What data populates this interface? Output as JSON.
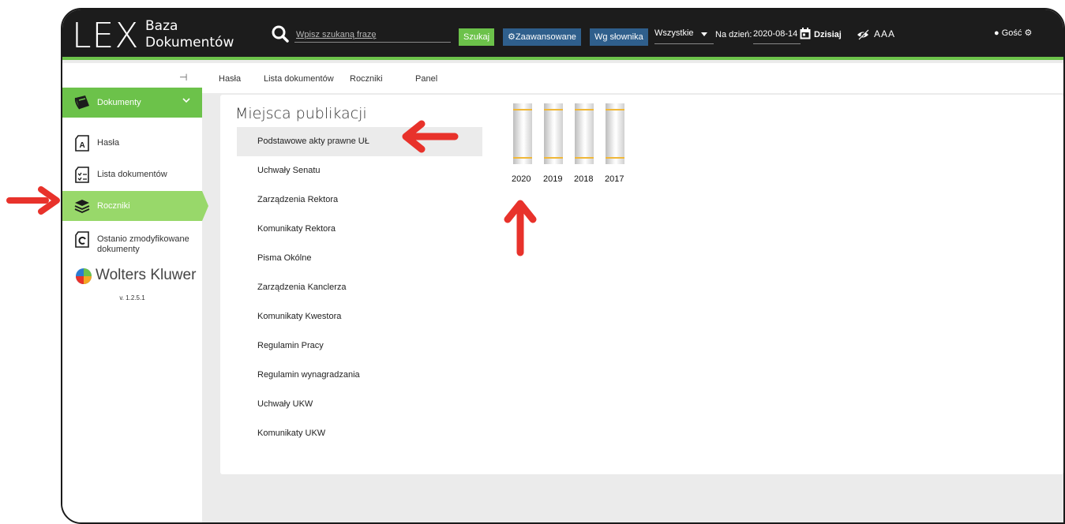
{
  "app": {
    "logo_main": "LEX",
    "logo_line1": "Baza",
    "logo_line2": "Dokumentów"
  },
  "search": {
    "placeholder": "Wpisz szukaną frazę",
    "search_label": "Szukaj",
    "advanced_label": "Zaawansowane",
    "dictionary_label": "Wg słownika",
    "scope_value": "Wszystkie",
    "date_label": "Na dzień:",
    "date_value": "2020-08-14",
    "today_label": "Dzisiaj",
    "font_size_label": "AAA"
  },
  "user": {
    "name": "Gość"
  },
  "sidebar": {
    "header_label": "Dokumenty",
    "items": [
      {
        "label": "Hasła",
        "icon": "document-a-icon"
      },
      {
        "label": "Lista dokumentów",
        "icon": "document-checklist-icon"
      },
      {
        "label": "Roczniki",
        "icon": "layers-icon",
        "active": true
      },
      {
        "label": "Ostanio zmodyfikowane dokumenty",
        "icon": "document-refresh-icon"
      }
    ],
    "brand": "Wolters Kluwer",
    "version": "v. 1.2.5.1"
  },
  "subnav": {
    "tabs": [
      "Hasła",
      "Lista dokumentów",
      "Roczniki",
      "Panel"
    ]
  },
  "main": {
    "title": "Miejsca publikacji",
    "publications": [
      "Podstawowe akty prawne UŁ",
      "Uchwały Senatu",
      "Zarządzenia Rektora",
      "Komunikaty Rektora",
      "Pisma Okólne",
      "Zarządzenia Kanclerza",
      "Komunikaty Kwestora",
      "Regulamin Pracy",
      "Regulamin wynagradzania",
      "Uchwały UKW",
      "Komunikaty UKW"
    ],
    "selected_publication": 0,
    "years": [
      "2020",
      "2019",
      "2018",
      "2017"
    ]
  },
  "colors": {
    "accent_green": "#6cc24a",
    "active_green": "#98d86a",
    "button_blue": "#2f5f8c",
    "annotation_red": "#e8322b",
    "topbar": "#1c1c1c"
  }
}
